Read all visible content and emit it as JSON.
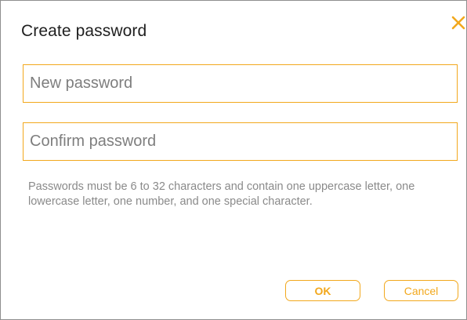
{
  "dialog": {
    "title": "Create password",
    "close_icon": "close-icon",
    "accent_color": "#f2a81d"
  },
  "fields": {
    "new_password": {
      "placeholder": "New password",
      "value": ""
    },
    "confirm_password": {
      "placeholder": "Confirm password",
      "value": ""
    }
  },
  "hint": {
    "text": "Passwords must be 6 to 32 characters and contain one uppercase letter, one lowercase letter, one number, and one special character."
  },
  "buttons": {
    "ok_label": "OK",
    "cancel_label": "Cancel"
  }
}
